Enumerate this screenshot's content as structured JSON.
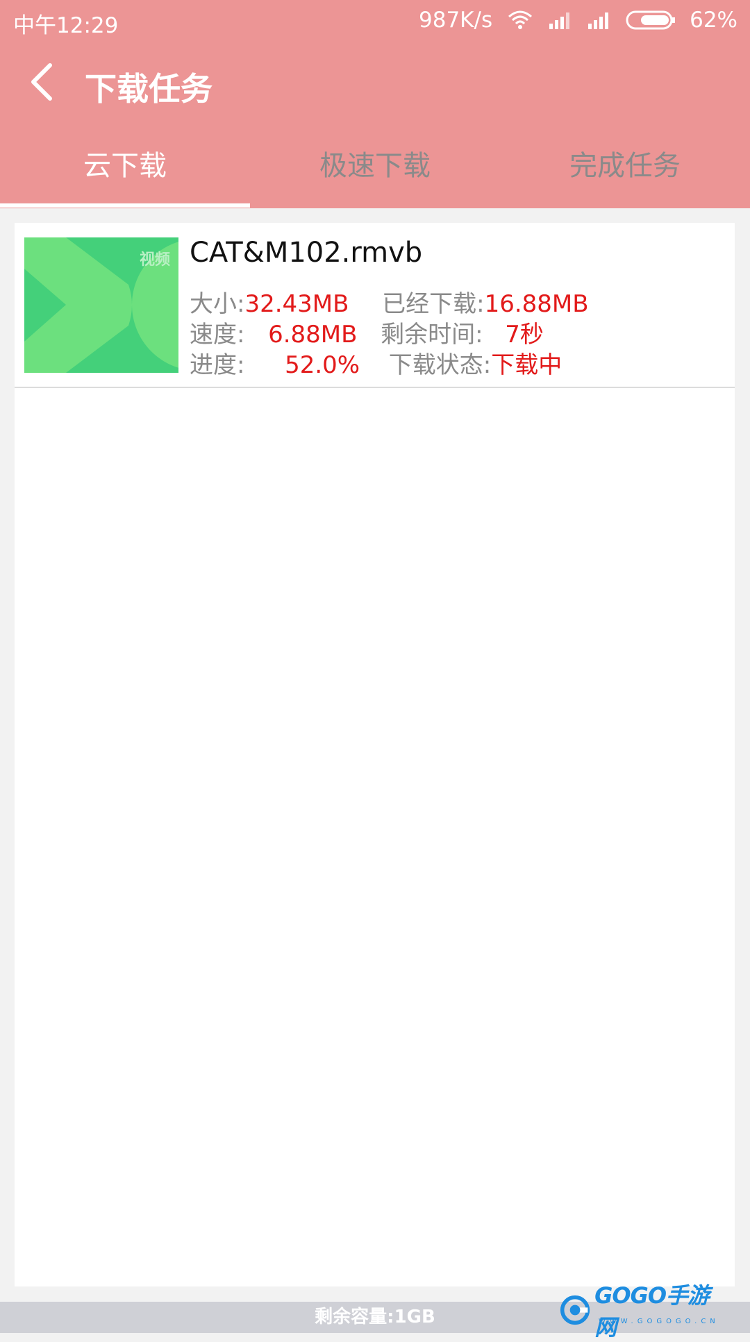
{
  "status_bar": {
    "time": "中午12:29",
    "network_speed": "987K/s",
    "battery": "62%",
    "icons": [
      "wifi-icon",
      "signal-icon",
      "signal-icon",
      "battery-icon"
    ]
  },
  "nav": {
    "back_icon": "chevron-left-icon",
    "title": "下载任务"
  },
  "tabs": [
    {
      "label": "云下载",
      "active": true
    },
    {
      "label": "极速下载",
      "active": false
    },
    {
      "label": "完成任务",
      "active": false
    }
  ],
  "tasks": [
    {
      "thumbnail_label": "视频",
      "file_name": "CAT&M102.rmvb",
      "size_label": "大小:",
      "size_value": "32.43MB",
      "downloaded_label": "已经下载:",
      "downloaded_value": "16.88MB",
      "speed_label": "速度:",
      "speed_value": "6.88MB",
      "remaining_label": "剩余时间:",
      "remaining_value": "7秒",
      "progress_label": "进度:",
      "progress_value": "52.0%",
      "status_label": "下载状态:",
      "status_value": "下载中"
    }
  ],
  "footer": {
    "capacity_text": "剩余容量:1GB"
  },
  "watermark": {
    "text": "GOGO手游网",
    "sub": "WWW.GOGOGO.CN"
  },
  "colors": {
    "header": "#ec9595",
    "accent_value": "#e21a1a",
    "thumbnail": "#44d07a"
  }
}
